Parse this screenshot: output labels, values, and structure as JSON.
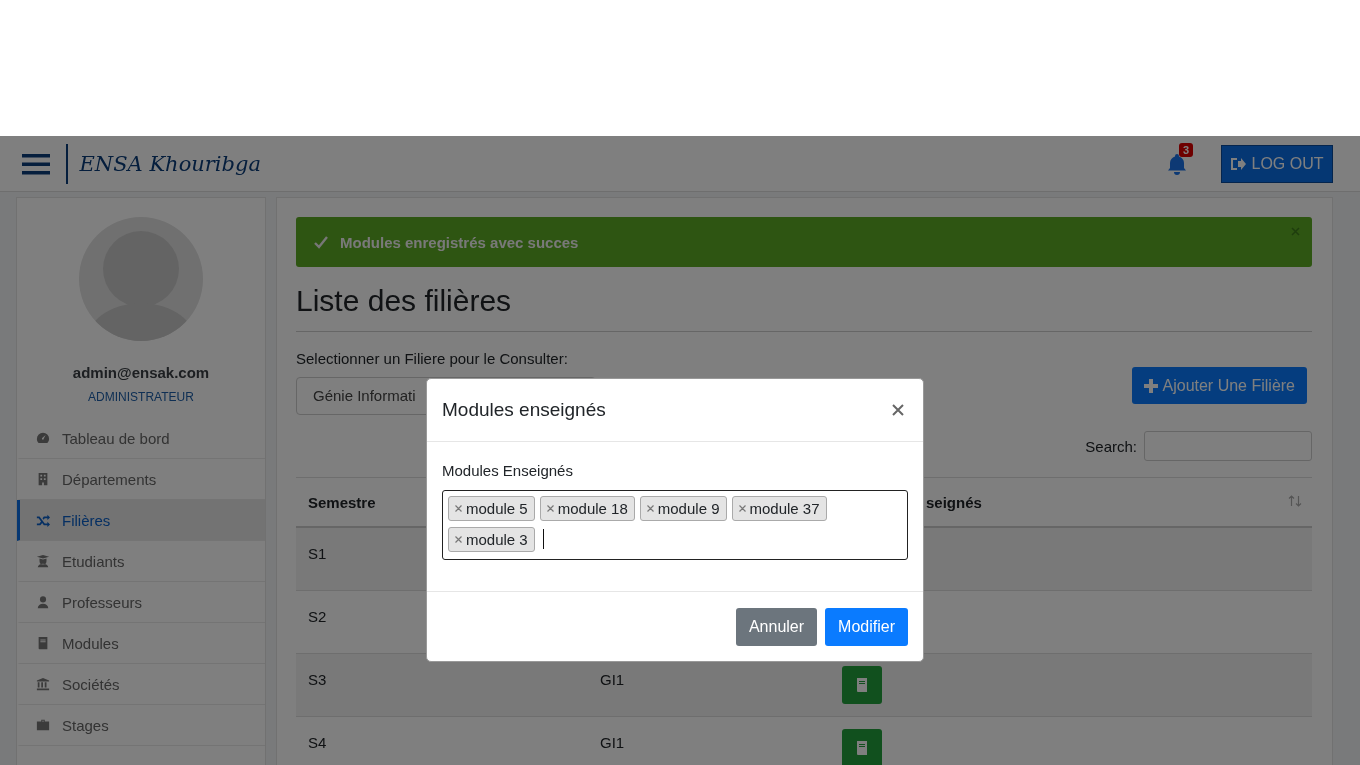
{
  "navbar": {
    "brand": "ENSA Khouribga",
    "notification_count": "3",
    "logout": "LOG OUT"
  },
  "sidebar": {
    "email": "admin@ensak.com",
    "role": "ADMINISTRATEUR",
    "items": [
      {
        "label": "Tableau de bord",
        "selected": false
      },
      {
        "label": "Départements",
        "selected": false
      },
      {
        "label": "Filières",
        "selected": true
      },
      {
        "label": "Etudiants",
        "selected": false
      },
      {
        "label": "Professeurs",
        "selected": false
      },
      {
        "label": "Modules",
        "selected": false
      },
      {
        "label": "Sociétés",
        "selected": false
      },
      {
        "label": "Stages",
        "selected": false
      }
    ]
  },
  "alert": {
    "message": "Modules enregistrés avec succes"
  },
  "page_title": "Liste des filières",
  "filter": {
    "label": "Selectionner un Filiere pour le Consulter:",
    "value": "Génie Informati"
  },
  "add_button": "Ajouter Une Filière",
  "search": {
    "label": "Search:"
  },
  "table": {
    "header": {
      "column_1": "Semestre",
      "column_3": "seignés"
    },
    "rows": [
      {
        "column_1": "S1"
      },
      {
        "column_1": "S2"
      },
      {
        "column_1": "S3",
        "column_2": "GI1"
      },
      {
        "column_1": "S4",
        "column_2": "GI1"
      }
    ]
  },
  "modal": {
    "title": "Modules enseignés",
    "field_label": "Modules Enseignés",
    "tags": [
      "module 5",
      "module 18",
      "module 9",
      "module 37",
      "module 3"
    ],
    "cancel": "Annuler",
    "submit": "Modifier"
  }
}
